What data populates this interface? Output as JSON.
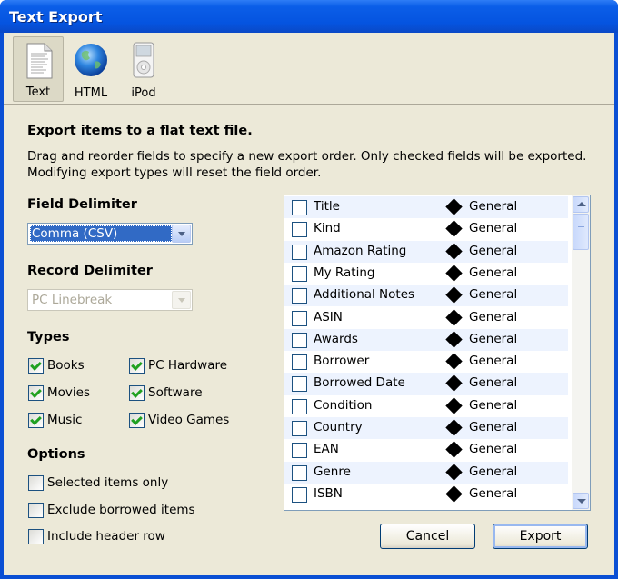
{
  "window": {
    "title": "Text Export"
  },
  "toolbar": {
    "items": [
      {
        "label": "Text",
        "icon": "text-document-icon",
        "active": true
      },
      {
        "label": "HTML",
        "icon": "globe-icon",
        "active": false
      },
      {
        "label": "iPod",
        "icon": "ipod-icon",
        "active": false
      }
    ]
  },
  "main": {
    "heading": "Export items to a flat text file.",
    "description_line1": "Drag and reorder fields to specify a new export order. Only checked fields will be exported.",
    "description_line2": "Modifying export types will reset the field order."
  },
  "field_delimiter": {
    "label": "Field Delimiter",
    "value": "Comma (CSV)"
  },
  "record_delimiter": {
    "label": "Record Delimiter",
    "value": "PC Linebreak",
    "disabled": true
  },
  "types": {
    "label": "Types",
    "items": [
      {
        "label": "Books",
        "checked": true
      },
      {
        "label": "PC Hardware",
        "checked": true
      },
      {
        "label": "Movies",
        "checked": true
      },
      {
        "label": "Software",
        "checked": true
      },
      {
        "label": "Music",
        "checked": true
      },
      {
        "label": "Video Games",
        "checked": true
      }
    ]
  },
  "options": {
    "label": "Options",
    "items": [
      {
        "label": "Selected items only",
        "checked": false
      },
      {
        "label": "Exclude borrowed items",
        "checked": false
      },
      {
        "label": "Include header row",
        "checked": false
      }
    ]
  },
  "fields": {
    "rows": [
      {
        "name": "Title",
        "type": "General",
        "checked": false
      },
      {
        "name": "Kind",
        "type": "General",
        "checked": false
      },
      {
        "name": "Amazon Rating",
        "type": "General",
        "checked": false
      },
      {
        "name": "My Rating",
        "type": "General",
        "checked": false
      },
      {
        "name": "Additional Notes",
        "type": "General",
        "checked": false
      },
      {
        "name": "ASIN",
        "type": "General",
        "checked": false
      },
      {
        "name": "Awards",
        "type": "General",
        "checked": false
      },
      {
        "name": "Borrower",
        "type": "General",
        "checked": false
      },
      {
        "name": "Borrowed Date",
        "type": "General",
        "checked": false
      },
      {
        "name": "Condition",
        "type": "General",
        "checked": false
      },
      {
        "name": "Country",
        "type": "General",
        "checked": false
      },
      {
        "name": "EAN",
        "type": "General",
        "checked": false
      },
      {
        "name": "Genre",
        "type": "General",
        "checked": false
      },
      {
        "name": "ISBN",
        "type": "General",
        "checked": false
      }
    ]
  },
  "buttons": {
    "cancel": "Cancel",
    "export": "Export"
  }
}
